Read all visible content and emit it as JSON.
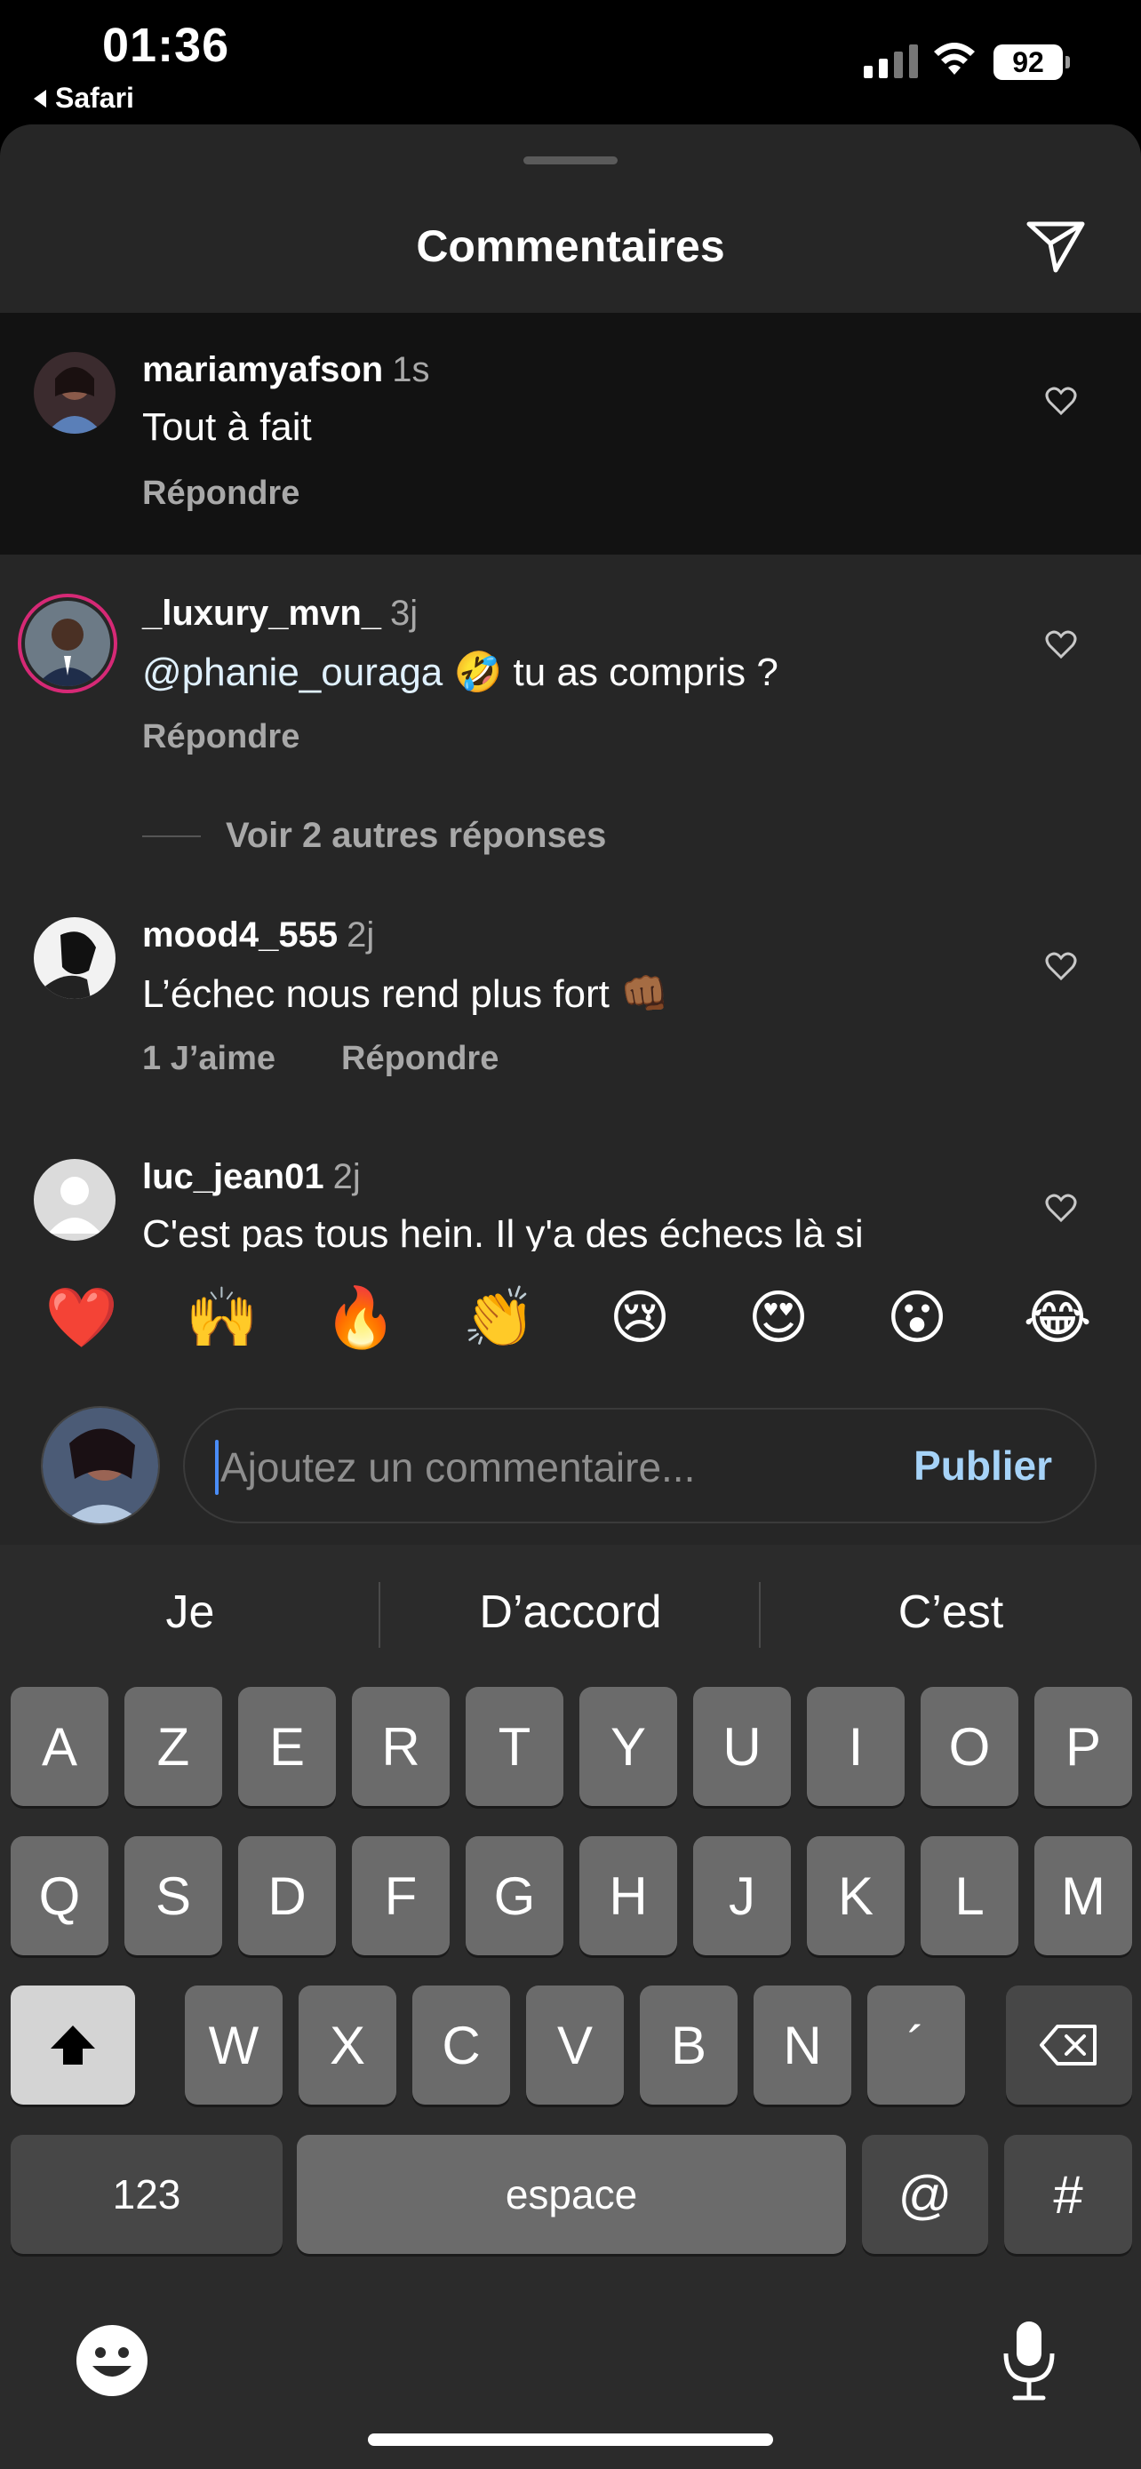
{
  "status_bar": {
    "time": "01:36",
    "back_app": "Safari",
    "battery": "92"
  },
  "sheet": {
    "title": "Commentaires"
  },
  "comments": [
    {
      "username": "mariamyafson",
      "time": "1s",
      "text": "Tout à fait",
      "reply_label": "Répondre"
    },
    {
      "username": "_luxury_mvn_",
      "time": "3j",
      "mention": "@phanie_ouraga",
      "emoji": "🤣",
      "text": "tu as compris ?",
      "reply_label": "Répondre"
    },
    {
      "username": "mood4_555",
      "time": "2j",
      "text": "L’échec nous rend plus fort",
      "emoji": "👊🏾",
      "likes_label": "1 J’aime",
      "reply_label": "Répondre"
    },
    {
      "username": "luc_jean01",
      "time": "2j",
      "text": "C'est pas tous hein. Il y'a des échecs là si"
    }
  ],
  "more_replies": "Voir 2 autres réponses",
  "emoji_bar": [
    "❤️",
    "🙌",
    "🔥",
    "👏",
    "😢",
    "😍",
    "😮",
    "😂"
  ],
  "composer": {
    "placeholder": "Ajoutez un commentaire...",
    "publish_label": "Publier"
  },
  "keyboard": {
    "suggestions": [
      "Je",
      "D’accord",
      "C’est"
    ],
    "row1": [
      "A",
      "Z",
      "E",
      "R",
      "T",
      "Y",
      "U",
      "I",
      "O",
      "P"
    ],
    "row2": [
      "Q",
      "S",
      "D",
      "F",
      "G",
      "H",
      "J",
      "K",
      "L",
      "M"
    ],
    "row3": [
      "W",
      "X",
      "C",
      "V",
      "B",
      "N",
      "´"
    ],
    "numbers_label": "123",
    "space_label": "espace",
    "at_label": "@",
    "hash_label": "#"
  },
  "colors": {
    "sheet_bg": "#262626",
    "highlight_bg": "#121212",
    "secondary_text": "#a8a8a8",
    "publish": "#a6d3f8",
    "key": "#6b6b6b"
  }
}
